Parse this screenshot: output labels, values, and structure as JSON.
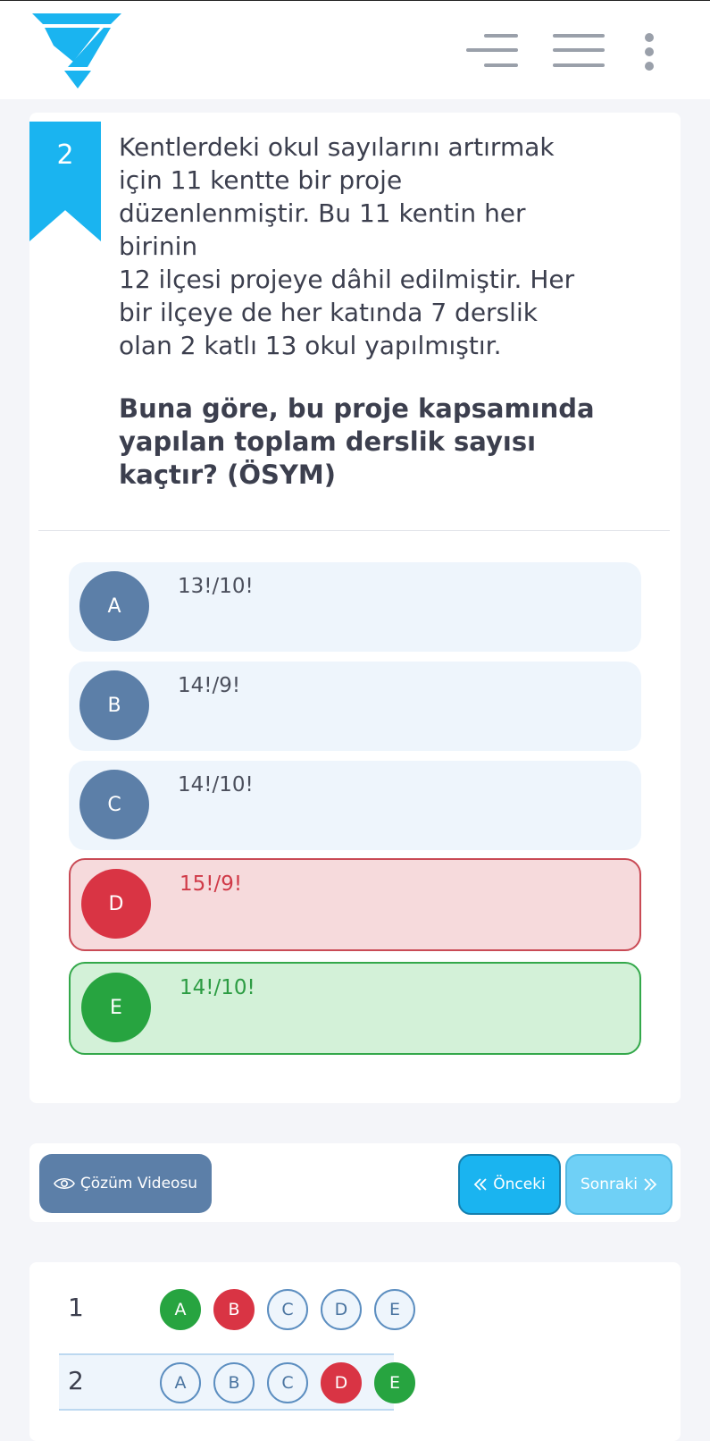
{
  "header": {
    "logo_icon": "triangle-logo",
    "menu_icons": [
      "list-icon",
      "menu-icon",
      "more-vertical-icon"
    ]
  },
  "question": {
    "number": "2",
    "text_lines": [
      "Kentlerdeki okul sayılarını artırmak",
      "için 11 kentte bir proje",
      "düzenlenmiştir. Bu 11 kentin her",
      "birinin",
      "12 ilçesi projeye dâhil edilmiştir. Her",
      "bir ilçeye de her katında 7 derslik",
      "olan 2 katlı 13 okul yapılmıştır."
    ],
    "prompt_lines": [
      "Buna göre, bu proje kapsamında",
      "yapılan toplam derslik sayısı",
      "kaçtır? (ÖSYM)"
    ]
  },
  "options": [
    {
      "letter": "A",
      "text": "13!/10!",
      "state": "neutral"
    },
    {
      "letter": "B",
      "text": "14!/9!",
      "state": "neutral"
    },
    {
      "letter": "C",
      "text": "14!/10!",
      "state": "neutral"
    },
    {
      "letter": "D",
      "text": "15!/9!",
      "state": "wrong"
    },
    {
      "letter": "E",
      "text": "14!/10!",
      "state": "correct"
    }
  ],
  "nav": {
    "video_label": "Çözüm Videosu",
    "video_icon": "eye-icon",
    "prev_label": "Önceki",
    "next_label": "Sonraki"
  },
  "answer_sheet": {
    "rows": [
      {
        "num": "1",
        "bubbles": [
          {
            "letter": "A",
            "state": "green"
          },
          {
            "letter": "B",
            "state": "red"
          },
          {
            "letter": "C",
            "state": "empty"
          },
          {
            "letter": "D",
            "state": "empty"
          },
          {
            "letter": "E",
            "state": "empty"
          }
        ]
      },
      {
        "num": "2",
        "bubbles": [
          {
            "letter": "A",
            "state": "empty"
          },
          {
            "letter": "B",
            "state": "empty"
          },
          {
            "letter": "C",
            "state": "empty"
          },
          {
            "letter": "D",
            "state": "red"
          },
          {
            "letter": "E",
            "state": "green"
          }
        ]
      }
    ]
  },
  "colors": {
    "accent": "#1ab4f0",
    "option_circle": "#5c7fa8",
    "wrong": "#d93444",
    "correct": "#27a440"
  }
}
